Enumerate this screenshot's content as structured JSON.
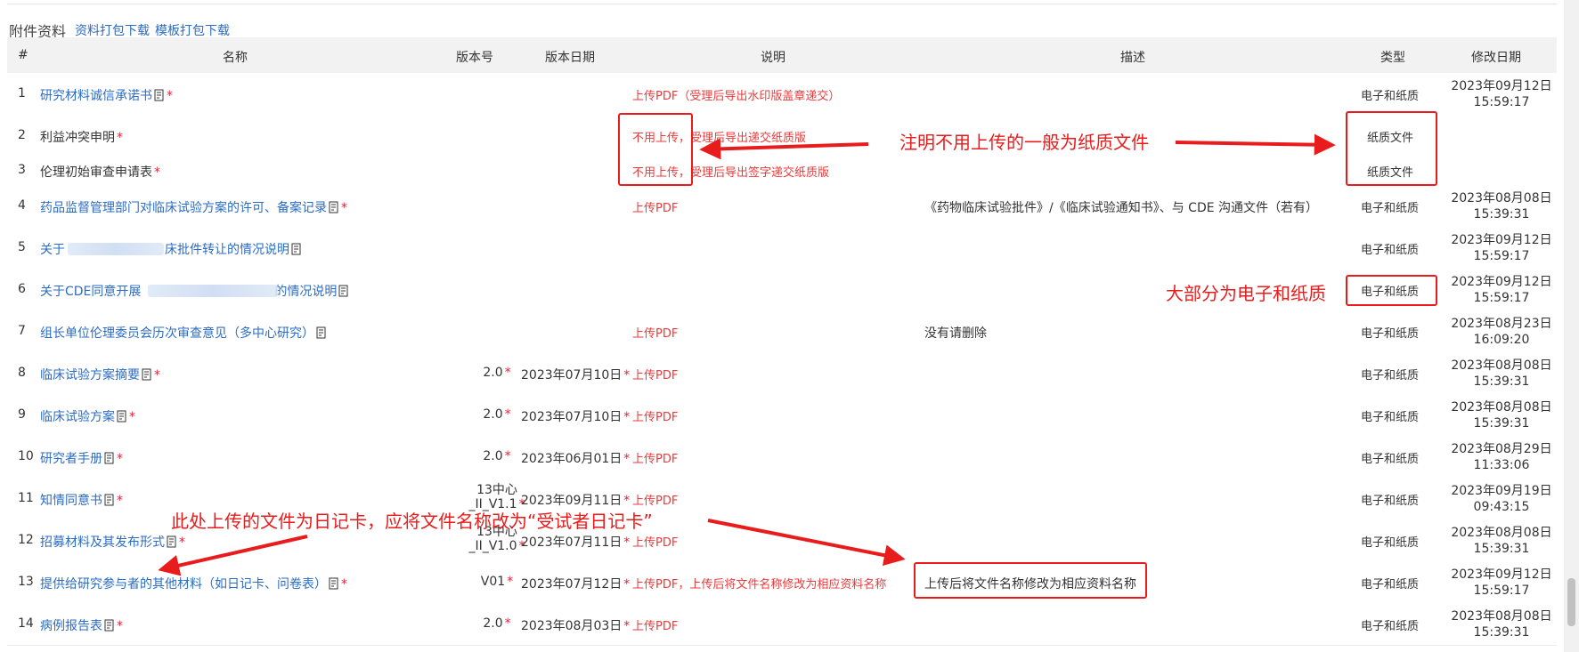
{
  "section": {
    "title": "附件资料",
    "links": [
      "资料打包下载",
      "模板打包下载"
    ]
  },
  "columns": [
    "#",
    "名称",
    "版本号",
    "版本日期",
    "说明",
    "描述",
    "类型",
    "修改日期"
  ],
  "rows": [
    {
      "idx": "1",
      "name": "研究材料诚信承诺书",
      "required": "*",
      "version": "",
      "date": "",
      "note": "上传PDF（受理后导出水印版盖章递交）",
      "desc": "",
      "type": "电子和纸质",
      "mod_date": "2023年09月12日",
      "mod_time": "15:59:17"
    },
    {
      "idx": "2",
      "name": "利益冲突申明",
      "required": "*",
      "version": "",
      "date": "",
      "note": "不用上传，受理后导出递交纸质版",
      "desc": "",
      "type": "纸质文件",
      "mod_date": "",
      "mod_time": ""
    },
    {
      "idx": "3",
      "name": "伦理初始审查申请表",
      "required": "*",
      "version": "",
      "date": "",
      "note": "不用上传，受理后导出签字递交纸质版",
      "desc": "",
      "type": "纸质文件",
      "mod_date": "",
      "mod_time": ""
    },
    {
      "idx": "4",
      "name": "药品监督管理部门对临床试验方案的许可、备案记录",
      "required": "*",
      "version": "",
      "date": "",
      "note": "上传PDF",
      "desc": "《药物临床试验批件》/《临床试验通知书》、与 CDE 沟通文件（若有）",
      "type": "电子和纸质",
      "mod_date": "2023年08月08日",
      "mod_time": "15:39:31"
    },
    {
      "idx": "5",
      "name_a": "关于",
      "name_b": "床批件转让的情况说明",
      "version": "",
      "date": "",
      "note": "",
      "desc": "",
      "type": "电子和纸质",
      "mod_date": "2023年09月12日",
      "mod_time": "15:59:17"
    },
    {
      "idx": "6",
      "name_a": "关于CDE同意开展",
      "name_b": "的情况说明",
      "version": "",
      "date": "",
      "note": "",
      "desc": "",
      "type": "电子和纸质",
      "mod_date": "2023年09月12日",
      "mod_time": "15:59:17"
    },
    {
      "idx": "7",
      "name": "组长单位伦理委员会历次审查意见（多中心研究）",
      "required": "",
      "version": "",
      "date": "",
      "note": "上传PDF",
      "desc": "没有请删除",
      "type": "电子和纸质",
      "mod_date": "2023年08月23日",
      "mod_time": "16:09:20"
    },
    {
      "idx": "8",
      "name": "临床试验方案摘要",
      "required": "*",
      "version": "2.0",
      "date": "2023年07月10日",
      "note": "上传PDF",
      "desc": "",
      "type": "电子和纸质",
      "mod_date": "2023年08月08日",
      "mod_time": "15:39:31"
    },
    {
      "idx": "9",
      "name": "临床试验方案",
      "required": "*",
      "version": "2.0",
      "date": "2023年07月10日",
      "note": "上传PDF",
      "desc": "",
      "type": "电子和纸质",
      "mod_date": "2023年08月08日",
      "mod_time": "15:39:31"
    },
    {
      "idx": "10",
      "name": "研究者手册",
      "required": "*",
      "version": "2.0",
      "date": "2023年06月01日",
      "note": "上传PDF",
      "desc": "",
      "type": "电子和纸质",
      "mod_date": "2023年08月29日",
      "mod_time": "11:33:06"
    },
    {
      "idx": "11",
      "name": "知情同意书",
      "required": "*",
      "version_l1": "13中心",
      "version_l2": "_II_V1.1",
      "date": "2023年09月11日",
      "note": "上传PDF",
      "desc": "",
      "type": "电子和纸质",
      "mod_date": "2023年09月19日",
      "mod_time": "09:43:15"
    },
    {
      "idx": "12",
      "name": "招募材料及其发布形式",
      "required": "*",
      "version_l1": "13中心",
      "version_l2": "_II_V1.0",
      "date": "2023年07月11日",
      "note": "上传PDF",
      "desc": "",
      "type": "电子和纸质",
      "mod_date": "2023年08月08日",
      "mod_time": "15:39:31"
    },
    {
      "idx": "13",
      "name": "提供给研究参与者的其他材料（如日记卡、问卷表）",
      "required": "*",
      "version": "V01",
      "date": "2023年07月12日",
      "note": "上传PDF，上传后将文件名称修改为相应资料名称",
      "desc": "上传后将文件名称修改为相应资料名称",
      "type": "电子和纸质",
      "mod_date": "2023年09月12日",
      "mod_time": "15:59:17"
    },
    {
      "idx": "14",
      "name": "病例报告表",
      "required": "*",
      "version": "2.0",
      "date": "2023年08月03日",
      "note": "上传PDF",
      "desc": "",
      "type": "电子和纸质",
      "mod_date": "2023年08月08日",
      "mod_time": "15:39:31"
    }
  ],
  "annotations": {
    "paper_note": "注明不用上传的一般为纸质文件",
    "majority_note": "大部分为电子和纸质",
    "diary_note": "此处上传的文件为日记卡，应将文件名称改为“受试者日记卡”"
  },
  "colors": {
    "link": "#2b6cc4",
    "note_red": "#ec3a3a",
    "annotation_red": "#e81c1c",
    "header_bg": "#f2f2f2"
  }
}
